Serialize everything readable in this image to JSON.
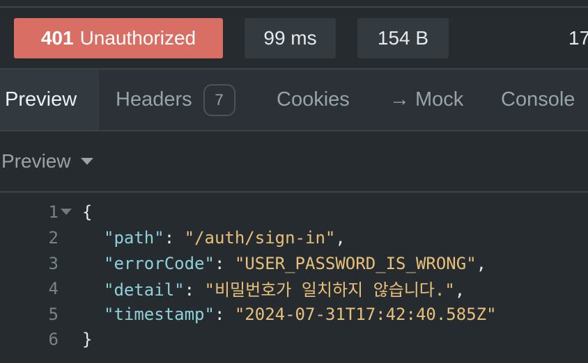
{
  "status_bar": {
    "status_code": "401",
    "status_text": "Unauthorized",
    "time": "99 ms",
    "size": "154 B",
    "more": "17"
  },
  "tabs": [
    {
      "label": "Preview",
      "active": true
    },
    {
      "label": "Headers",
      "badge": "7"
    },
    {
      "label": "Cookies"
    },
    {
      "arrow": "→",
      "label": "Mock"
    },
    {
      "label": "Console"
    }
  ],
  "preview_mode": {
    "label": "Preview"
  },
  "code": {
    "lines": [
      {
        "num": "1",
        "open": "{"
      },
      {
        "num": "2",
        "key": "\"path\"",
        "sep": ": ",
        "value": "\"/auth/sign-in\"",
        "end": ","
      },
      {
        "num": "3",
        "key": "\"errorCode\"",
        "sep": ": ",
        "value": "\"USER_PASSWORD_IS_WRONG\"",
        "end": ","
      },
      {
        "num": "4",
        "key": "\"detail\"",
        "sep": ": ",
        "value": "\"비밀번호가 일치하지 않습니다.\"",
        "end": ","
      },
      {
        "num": "5",
        "key": "\"timestamp\"",
        "sep": ": ",
        "value": "\"2024-07-31T17:42:40.585Z\"",
        "end": ""
      },
      {
        "num": "6",
        "open": "}"
      }
    ]
  },
  "colors": {
    "status_error": "#d96f64",
    "key": "#8fd1d9",
    "string": "#e8c07a",
    "background": "#262b30"
  }
}
